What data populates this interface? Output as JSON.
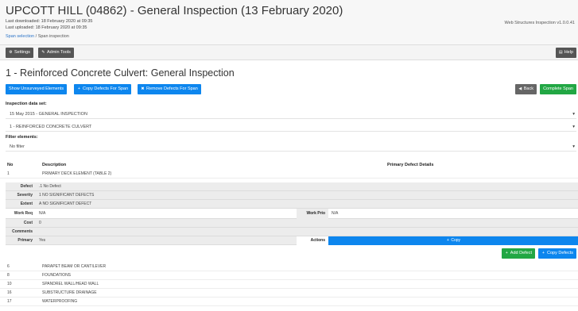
{
  "header": {
    "title": "UPCOTT HILL (04862) - General Inspection (13 February 2020)",
    "last_downloaded": "Last downloaded: 18 February 2020 at 09:35",
    "last_uploaded": "Last uploaded: 18 February 2020 at 09:35",
    "breadcrumb_link": "Span selection",
    "breadcrumb_sep": " / ",
    "breadcrumb_current": "Span inspection",
    "version": "Web Structures Inspection v1.0.0.41"
  },
  "toolbar": {
    "settings_label": "Settings",
    "admin_label": "Admin Tools",
    "help_label": "Help"
  },
  "page_title": "1 - Reinforced Concrete Culvert: General Inspection",
  "actions": {
    "show_unsurveyed": "Show Unsurveyed Elements",
    "copy_defects_for_span": "Copy Defects For Span",
    "remove_defects_for_span": "Remove Defects For Span",
    "back": "Back",
    "complete_span": "Complete Span"
  },
  "inspection_data_set": {
    "label": "Inspection data set:",
    "selected": "15 May 2015 - GENERAL INSPECTION",
    "span_selected": "1 - REINFORCED CONCRETE CULVERT"
  },
  "filter": {
    "label": "Filter elements:",
    "selected": "No filter"
  },
  "table": {
    "col_no": "No",
    "col_description": "Description",
    "col_primary_defect": "Primary Defect Details",
    "first_row": {
      "no": "1",
      "description": "PRIMARY DECK ELEMENT (TABLE 2)"
    },
    "rows": [
      {
        "no": "6",
        "description": "PARAPET BEAM OR CANTILEVER"
      },
      {
        "no": "8",
        "description": "FOUNDATIONS"
      },
      {
        "no": "10",
        "description": "SPANDREL WALL/HEAD WALL"
      },
      {
        "no": "16",
        "description": "SUBSTRUCTURE DRAINAGE"
      },
      {
        "no": "17",
        "description": "WATERPROOFING"
      }
    ]
  },
  "defect": {
    "defect_label": "Defect",
    "defect_value": ".1 No Defect",
    "severity_label": "Severity",
    "severity_value": "1 NO SIGNIFICANT DEFECTS",
    "extent_label": "Extent",
    "extent_value": "A NO SIGNIFICANT DEFECT",
    "work_req_label": "Work Req",
    "work_req_value": "N/A",
    "work_prio_label": "Work Prio",
    "work_prio_value": "N/A",
    "cost_label": "Cost",
    "cost_value": "0",
    "comments_label": "Comments",
    "comments_value": "",
    "primary_label": "Primary",
    "primary_value": "Yes",
    "actions_label": "Actions",
    "copy_label": "Copy",
    "add_defect": "Add Defect",
    "copy_defects": "Copy Defects"
  }
}
